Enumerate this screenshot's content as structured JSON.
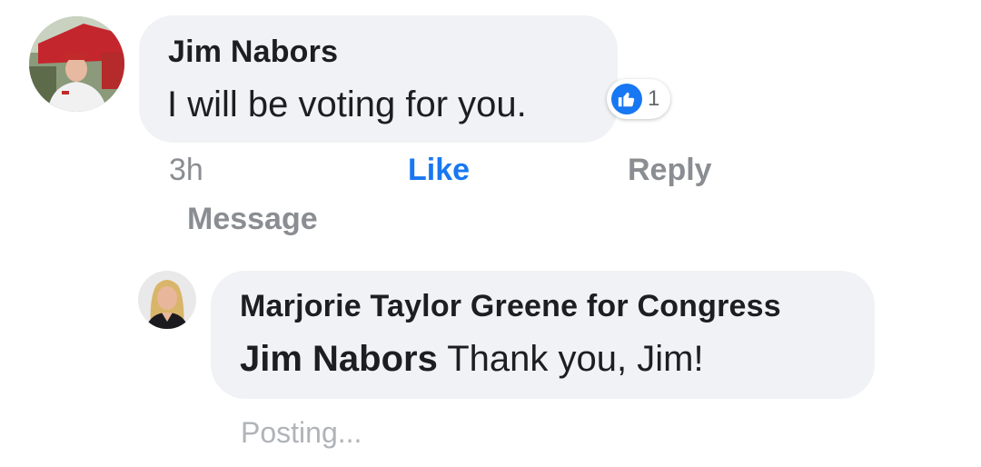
{
  "colors": {
    "bubble_bg": "#f0f2f5",
    "text_primary": "#1c1e21",
    "text_secondary": "#8a8d91",
    "link_blue": "#1877f2",
    "posting_gray": "#b0b3b8"
  },
  "comment": {
    "author": "Jim Nabors",
    "text": "I will be voting for you.",
    "avatar_icon": "profile-photo-man-red-cap",
    "reactions": {
      "icon": "thumbs-up-icon",
      "count": "1"
    },
    "actions": {
      "time": "3h",
      "like": "Like",
      "reply": "Reply",
      "message": "Message"
    }
  },
  "reply": {
    "author": "Marjorie Taylor Greene for Congress",
    "mention": "Jim Nabors",
    "text": " Thank you, Jim!",
    "avatar_icon": "profile-photo-woman-blonde",
    "status": "Posting..."
  }
}
